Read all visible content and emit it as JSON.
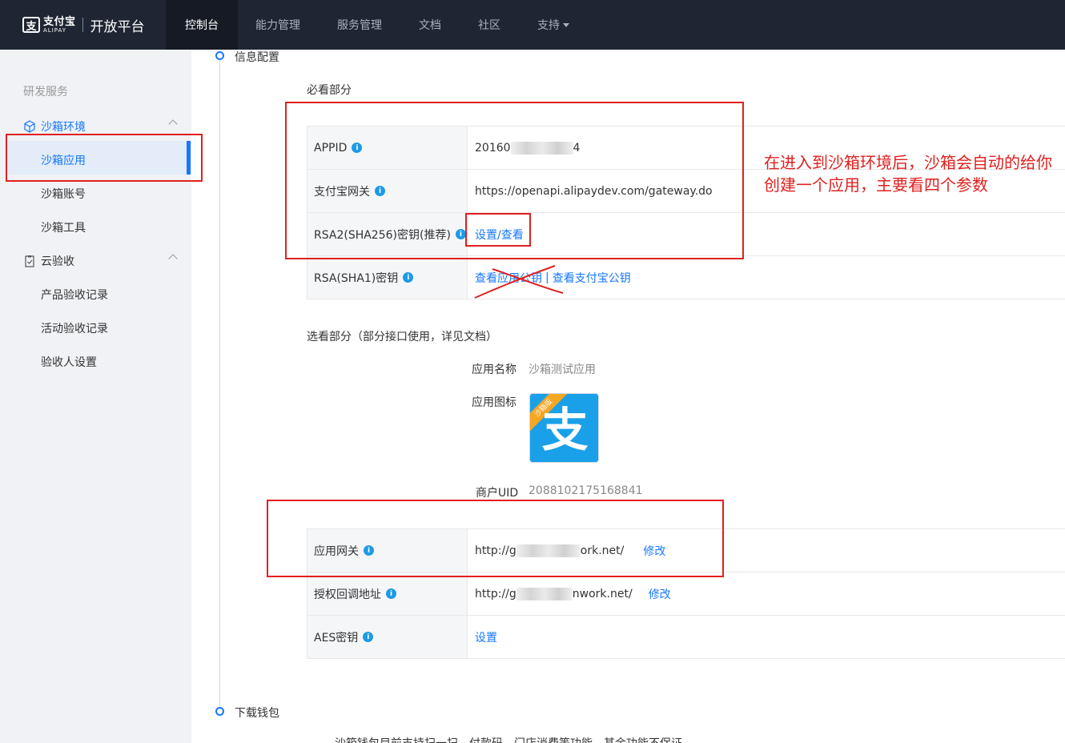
{
  "header": {
    "logo_cn": "支付宝",
    "logo_en": "ALIPAY",
    "logo_badge": "支",
    "platform": "开放平台",
    "nav": [
      {
        "label": "控制台",
        "active": true
      },
      {
        "label": "能力管理",
        "active": false
      },
      {
        "label": "服务管理",
        "active": false
      },
      {
        "label": "文档",
        "active": false
      },
      {
        "label": "社区",
        "active": false
      },
      {
        "label": "支持",
        "active": false
      }
    ]
  },
  "sidebar": {
    "group_title": "研发服务",
    "sections": [
      {
        "label": "沙箱环境",
        "icon": "cube-icon",
        "items": [
          "沙箱应用",
          "沙箱账号",
          "沙箱工具"
        ]
      },
      {
        "label": "云验收",
        "icon": "clipboard-check-icon",
        "items": [
          "产品验收记录",
          "活动验收记录",
          "验收人设置"
        ]
      }
    ]
  },
  "main": {
    "step1": "信息配置",
    "required_title": "必看部分",
    "required_rows": [
      {
        "key": "APPID",
        "value_prefix": "20160",
        "value_suffix": "4"
      },
      {
        "key": "支付宝网关",
        "value": "https://openapi.alipaydev.com/gateway.do"
      },
      {
        "key": "RSA2(SHA256)密钥(推荐)",
        "link": "设置/查看"
      },
      {
        "key": "RSA(SHA1)密钥",
        "link1": "查看应用公钥",
        "sep": "|",
        "link2": "查看支付宝公钥"
      }
    ],
    "optional_title": "选看部分（部分接口使用，详见文档）",
    "app_name_label": "应用名称",
    "app_name_value": "沙箱测试应用",
    "app_icon_label": "应用图标",
    "app_icon_ribbon": "沙箱版",
    "app_icon_glyph": "支",
    "uid_label": "商户UID",
    "uid_value": "2088102175168841",
    "optional_rows": [
      {
        "key": "应用网关",
        "value_prefix": "http://g",
        "value_suffix": "ork.net/",
        "link": "修改"
      },
      {
        "key": "授权回调地址",
        "value_prefix": "http://g",
        "value_suffix": "nwork.net/",
        "link": "修改"
      },
      {
        "key": "AES密钥",
        "link": "设置"
      }
    ],
    "step2": "下载钱包",
    "bottom_note": "沙箱钱包目前支持扫一扫、付款码、门店消费等功能，其余功能不保证"
  },
  "annotation": "在进入到沙箱环境后，沙箱会自动的给你创建一个应用，主要看四个参数",
  "colors": {
    "accent": "#1677ff",
    "nav_bg": "#1f2533",
    "annotation_red": "#e02020"
  }
}
